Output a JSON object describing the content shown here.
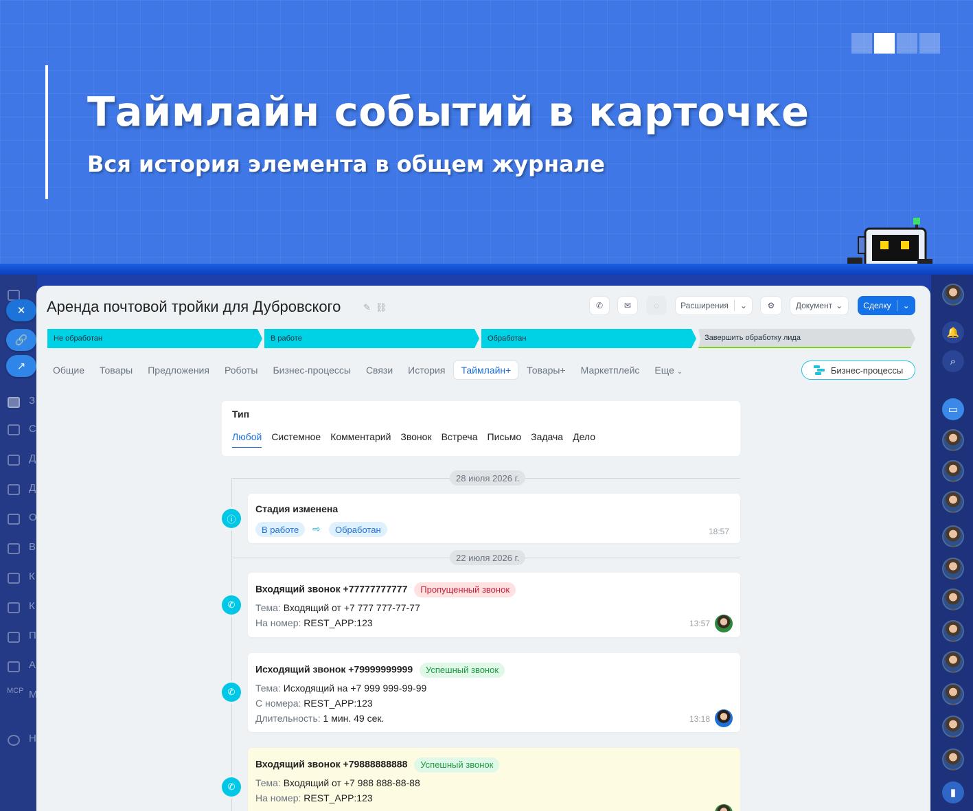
{
  "banner": {
    "title": "Таймлайн событий в карточке",
    "subtitle": "Вся история элемента в общем журнале",
    "pager_total": 4,
    "pager_active": 2
  },
  "left_rail": {
    "items": [
      "З",
      "С",
      "Д",
      "Д",
      "О",
      "В",
      "К",
      "К",
      "П",
      "А",
      "М",
      "Н"
    ],
    "mcp_label": "MCP"
  },
  "card": {
    "title": "Аренда почтовой тройки для Дубровского",
    "toolbar": {
      "extensions_label": "Расширения",
      "document_label": "Документ",
      "deal_label": "Сделку"
    },
    "stages": [
      {
        "label": "Не обработан"
      },
      {
        "label": "В работе"
      },
      {
        "label": "Обработан"
      },
      {
        "label": "Завершить обработку лида"
      }
    ],
    "tabs": [
      "Общие",
      "Товары",
      "Предложения",
      "Роботы",
      "Бизнес-процессы",
      "Связи",
      "История",
      "Таймлайн+",
      "Товары+",
      "Маркетплейс",
      "Еще"
    ],
    "active_tab": "Таймлайн+",
    "bp_button_label": "Бизнес-процессы"
  },
  "filter": {
    "label": "Тип",
    "options": [
      "Любой",
      "Системное",
      "Комментарий",
      "Звонок",
      "Встреча",
      "Письмо",
      "Задача",
      "Дело"
    ],
    "active": "Любой"
  },
  "timeline": {
    "dates": [
      "28 июля 2026 г.",
      "22 июля 2026 г."
    ],
    "stage_change": {
      "title": "Стадия изменена",
      "from": "В работе",
      "to": "Обработан",
      "time": "18:57"
    },
    "calls": [
      {
        "title": "Входящий звонок +77777777777",
        "badge": "Пропущенный звонок",
        "badge_kind": "missed",
        "subject_key": "Тема:",
        "subject": "Входящий от +7 777 777-77-77",
        "number_key": "На номер:",
        "number": "REST_APP:123",
        "time": "13:57"
      },
      {
        "title": "Исходящий звонок +79999999999",
        "badge": "Успешный звонок",
        "badge_kind": "ok",
        "subject_key": "Тема:",
        "subject": "Исходящий на +7 999 999-99-99",
        "number_key": "С номера:",
        "number": "REST_APP:123",
        "duration_key": "Длительность:",
        "duration": "1 мин. 49 сек.",
        "time": "13:18"
      },
      {
        "title": "Входящий звонок +79888888888",
        "badge": "Успешный звонок",
        "badge_kind": "ok",
        "subject_key": "Тема:",
        "subject": "Входящий от +7 988 888-88-88",
        "number_key": "На номер:",
        "number": "REST_APP:123"
      }
    ]
  },
  "colors": {
    "stage_done": "#00d2e6",
    "accent": "#1571e8",
    "missed": "#c3223a",
    "success": "#1c9a40"
  }
}
